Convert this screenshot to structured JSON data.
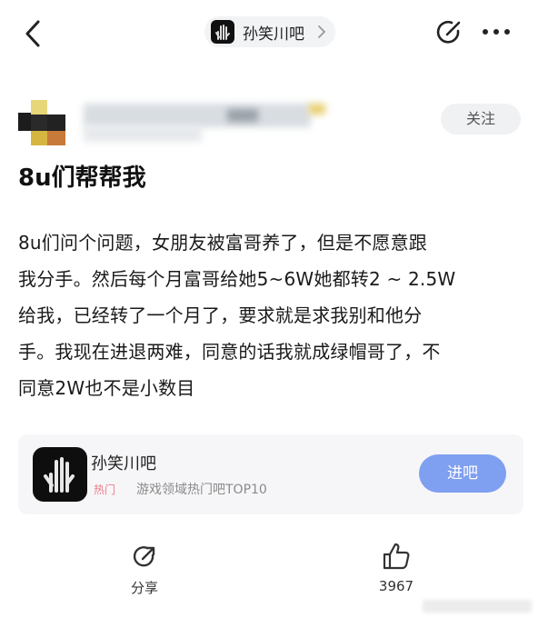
{
  "header": {
    "forum_name": "孙笑川吧"
  },
  "post": {
    "follow_label": "关注",
    "title": "8u们帮帮我",
    "content_lines": [
      "8u们问个问题，女朋友被富哥养了，但是不愿意跟",
      "我分手。然后每个月富哥给她5~6W她都转2 ~ 2.5W",
      "给我，已经转了一个月了，要求就是求我别和他分",
      "手。我现在进退两难，同意的话我就成绿帽哥了，不",
      "同意2W也不是小数目"
    ]
  },
  "forum_card": {
    "name": "孙笑川吧",
    "hot_badge": "热门",
    "hot_desc": "游戏领域热门吧TOP10",
    "enter_label": "进吧"
  },
  "actions": {
    "share_label": "分享",
    "like_count": "3967"
  }
}
